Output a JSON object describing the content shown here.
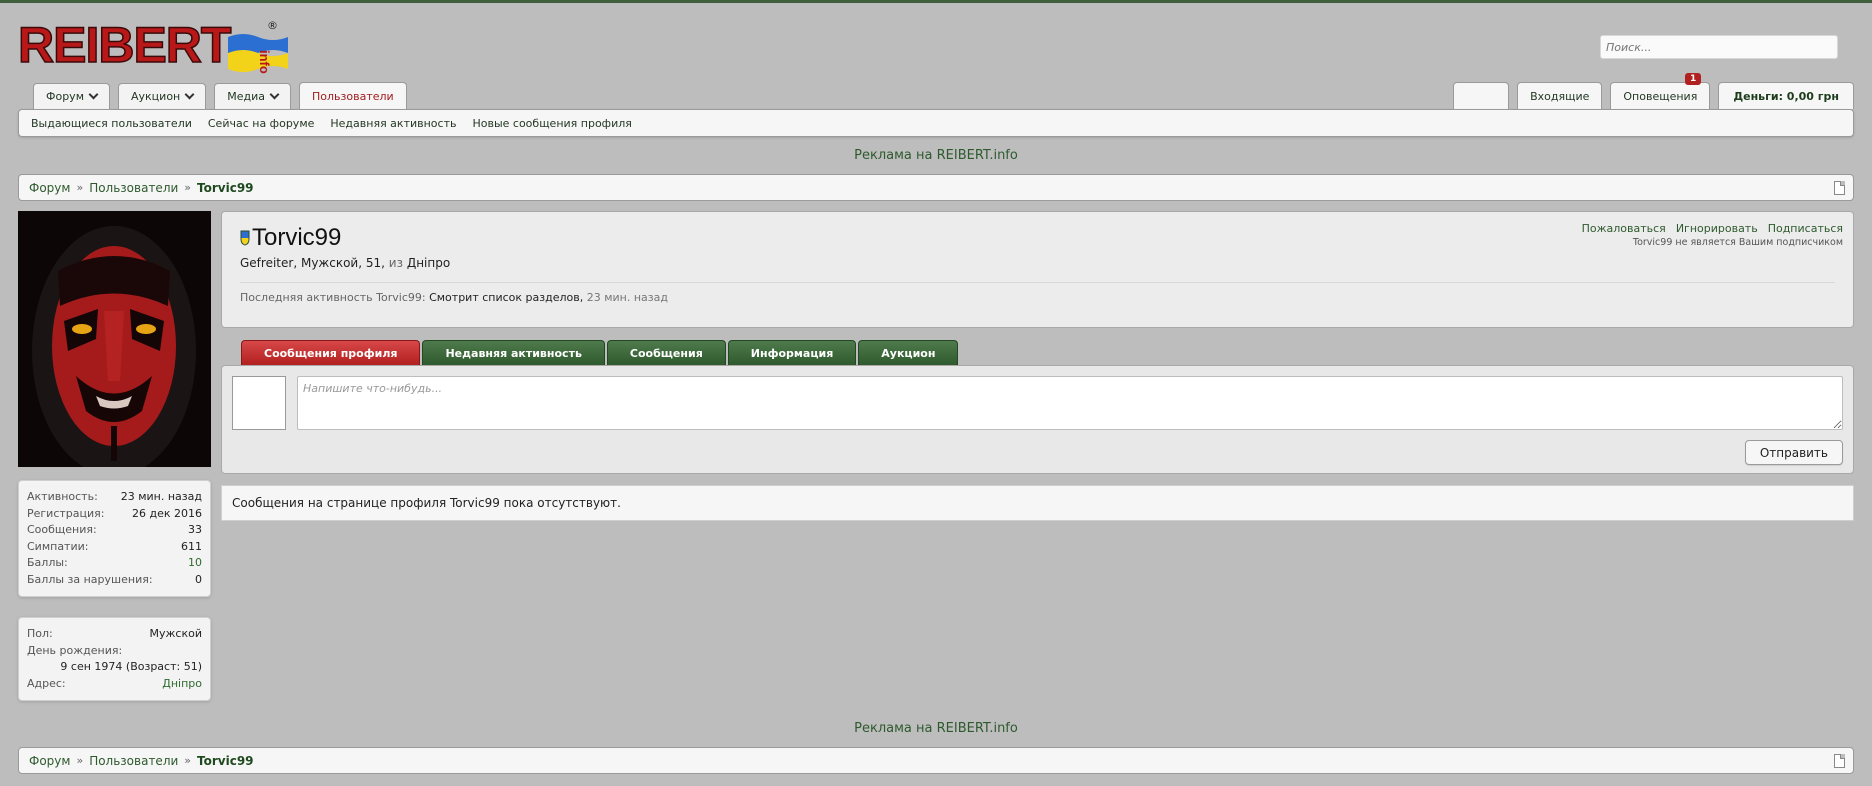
{
  "logo": {
    "text": "REIBERT",
    "suffix": "info",
    "reg": "®"
  },
  "search": {
    "placeholder": "Поиск..."
  },
  "nav": {
    "tabs": [
      {
        "label": "Форум",
        "dropdown": true
      },
      {
        "label": "Аукцион",
        "dropdown": true
      },
      {
        "label": "Медиа",
        "dropdown": true
      },
      {
        "label": "Пользователи",
        "active": true
      }
    ],
    "right": {
      "inbox": "Входящие",
      "alerts": "Оповещения",
      "alerts_count": "1",
      "money": "Деньги: 0,00 грн"
    },
    "subnav": [
      "Выдающиеся пользователи",
      "Сейчас на форуме",
      "Недавняя активность",
      "Новые сообщения профиля"
    ]
  },
  "ad": {
    "text": "Реклама на REIBERT.info"
  },
  "breadcrumb": {
    "items": [
      "Форум",
      "Пользователи"
    ],
    "current": "Torvic99",
    "sep": "»"
  },
  "stats": {
    "activity": {
      "k": "Активность:",
      "v": "23 мин. назад"
    },
    "registered": {
      "k": "Регистрация:",
      "v": "26 дек 2016"
    },
    "messages": {
      "k": "Сообщения:",
      "v": "33"
    },
    "likes": {
      "k": "Симпатии:",
      "v": "611"
    },
    "points": {
      "k": "Баллы:",
      "v": "10"
    },
    "warnings": {
      "k": "Баллы за нарушения:",
      "v": "0"
    }
  },
  "info": {
    "gender": {
      "k": "Пол:",
      "v": "Мужской"
    },
    "birthday": {
      "k": "День рождения:",
      "v": "9 сен 1974 (Возраст: 51)"
    },
    "address": {
      "k": "Адрес:",
      "v": "Дніпро"
    }
  },
  "profile": {
    "username": "Torvic99",
    "title": "Gefreiter",
    "gender": "Мужской",
    "age": "51",
    "from_label": "из",
    "location": "Дніпро",
    "last_activity_label": "Последняя активность Torvic99:",
    "last_activity": "Смотрит список разделов,",
    "last_activity_time": "23 мин. назад",
    "report": "Пожаловаться",
    "ignore": "Игнорировать",
    "follow": "Подписаться",
    "follow_note": "Torvic99 не является Вашим подписчиком"
  },
  "profile_tabs": [
    "Сообщения профиля",
    "Недавняя активность",
    "Сообщения",
    "Информация",
    "Аукцион"
  ],
  "compose": {
    "placeholder": "Напишите что-нибудь...",
    "send": "Отправить"
  },
  "empty_message": "Сообщения на странице профиля Torvic99 пока отсутствуют.",
  "colors": {
    "accent_green": "#2e5a2e",
    "accent_red": "#b21f1f",
    "background": "#bdbdbd"
  }
}
